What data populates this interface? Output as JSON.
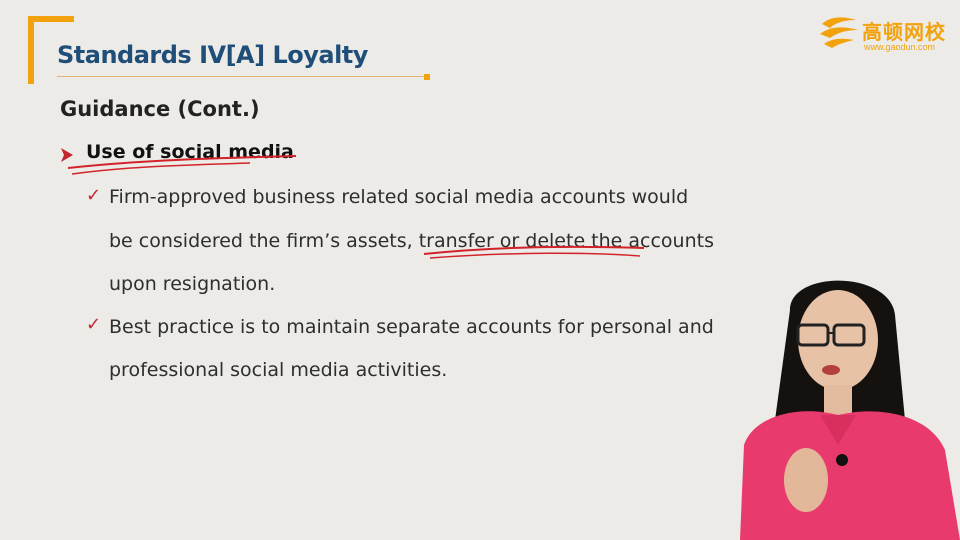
{
  "slide": {
    "title": "Standards IV[A] Loyalty",
    "subtitle": "Guidance (Cont.)",
    "bullet": "Use of social media",
    "points": [
      {
        "lines": [
          "Firm-approved business related social media accounts would",
          "be considered the firm’s assets, transfer or delete the accounts",
          "upon resignation."
        ]
      },
      {
        "lines": [
          "Best practice is to maintain separate accounts for personal and",
          "professional social media activities."
        ]
      }
    ]
  },
  "logo": {
    "name": "高顿网校",
    "url": "www.gaodun.com"
  },
  "colors": {
    "accent": "#f2a20c",
    "title": "#1f4e79",
    "check": "#c0282d",
    "ink": "#d2232a"
  },
  "icons": {
    "bullet": "arrow-bullet-icon",
    "check": "checkmark-icon"
  }
}
